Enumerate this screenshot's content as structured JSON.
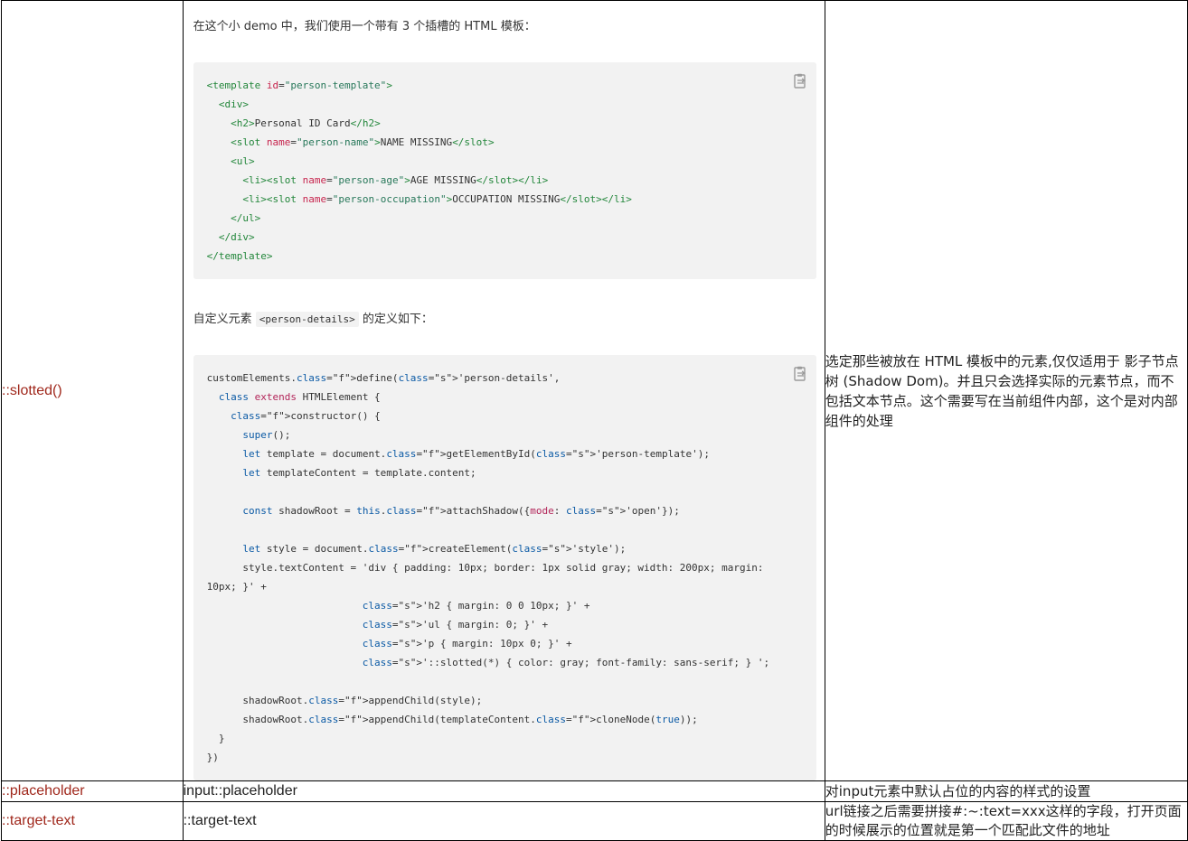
{
  "rows": [
    {
      "property": "::slotted()",
      "intro": "在这个小 demo 中，我们使用一个带有 3 个插槽的 HTML 模板：",
      "template_code": [
        "<template id=\"person-template\">",
        "  <div>",
        "    <h2>Personal ID Card</h2>",
        "    <slot name=\"person-name\">NAME MISSING</slot>",
        "    <ul>",
        "      <li><slot name=\"person-age\">AGE MISSING</slot></li>",
        "      <li><slot name=\"person-occupation\">OCCUPATION MISSING</slot></li>",
        "    </ul>",
        "  </div>",
        "</template>"
      ],
      "custom_el_text_before": "自定义元素 ",
      "custom_el_code": "<person-details>",
      "custom_el_text_after": " 的定义如下：",
      "js_code": [
        "customElements.define('person-details',",
        "  class extends HTMLElement {",
        "    constructor() {",
        "      super();",
        "      let template = document.getElementById('person-template');",
        "      let templateContent = template.content;",
        "",
        "      const shadowRoot = this.attachShadow({mode: 'open'});",
        "",
        "      let style = document.createElement('style');",
        "      style.textContent = 'div { padding: 10px; border: 1px solid gray; width: 200px; margin:",
        "10px; }' +",
        "                          'h2 { margin: 0 0 10px; }' +",
        "                          'ul { margin: 0; }' +",
        "                          'p { margin: 10px 0; }' +",
        "                          '::slotted(*) { color: gray; font-family: sans-serif; } ';",
        "",
        "      shadowRoot.appendChild(style);",
        "      shadowRoot.appendChild(templateContent.cloneNode(true));",
        "  }",
        "})"
      ],
      "description": "选定那些被放在 HTML 模板中的元素,仅仅适用于 影子节点树 (Shadow Dom)。并且只会选择实际的元素节点，而不包括文本节点。这个需要写在当前组件内部，这个是对内部组件的处理"
    },
    {
      "property": "::placeholder",
      "example": "input::placeholder",
      "description": "对input元素中默认占位的内容的样式的设置"
    },
    {
      "property": "::target-text",
      "example": "::target-text",
      "description": "url链接之后需要拼接#:~:text=xxx这样的字段，打开页面的时候展示的位置就是第一个匹配此文件的地址"
    }
  ],
  "colors": {
    "property_text": "#a0281c",
    "code_bg": "#f2f2f2"
  },
  "icons": [
    "copy-icon"
  ]
}
